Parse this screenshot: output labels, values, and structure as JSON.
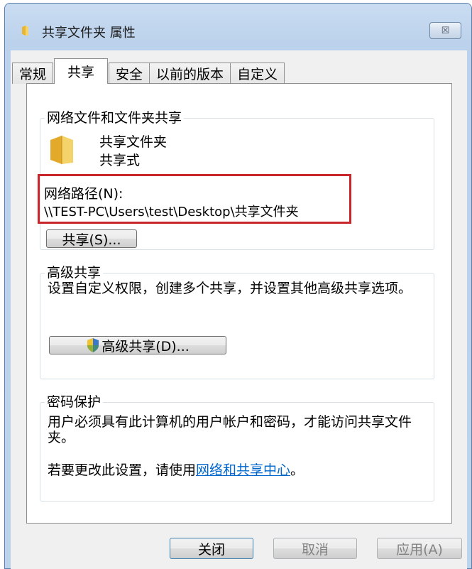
{
  "window": {
    "title": "共享文件夹 属性",
    "close_glyph": "☒"
  },
  "tabs": [
    {
      "label": "常规",
      "active": false
    },
    {
      "label": "共享",
      "active": true
    },
    {
      "label": "安全",
      "active": false
    },
    {
      "label": "以前的版本",
      "active": false
    },
    {
      "label": "自定义",
      "active": false
    }
  ],
  "network_sharing": {
    "title": "网络文件和文件夹共享",
    "folder_name": "共享文件夹",
    "status": "共享式",
    "path_label": "网络路径(N):",
    "path_value": "\\\\TEST-PC\\Users\\test\\Desktop\\共享文件夹",
    "share_button": "共享(S)...",
    "highlight_color": "#c8262b"
  },
  "advanced_sharing": {
    "title": "高级共享",
    "description": "设置自定义权限，创建多个共享，并设置其他高级共享选项。",
    "button": "高级共享(D)..."
  },
  "password_protection": {
    "title": "密码保护",
    "description": "用户必须具有此计算机的用户帐户和密码，才能访问共享文件夹。",
    "change_prefix": "若要更改此设置，请使用",
    "link_text": "网络和共享中心",
    "change_suffix": "。"
  },
  "buttons": {
    "close": "关闭",
    "cancel": "取消",
    "apply": "应用(A)"
  }
}
